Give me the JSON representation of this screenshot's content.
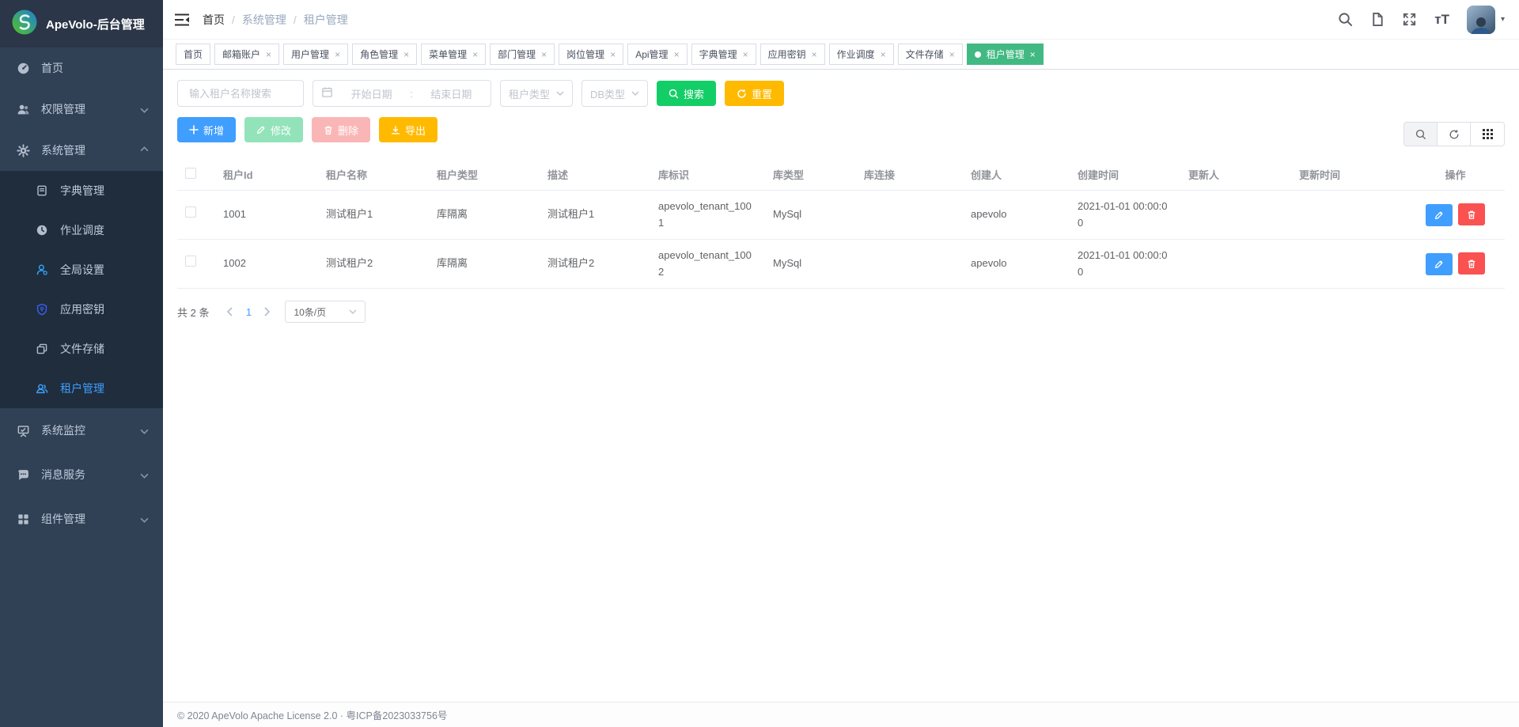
{
  "app": {
    "title": "ApeVolo-后台管理"
  },
  "colors": {
    "sidebar_bg": "#304156",
    "submenu_bg": "#1f2d3d",
    "active_link": "#409eff",
    "tab_active_bg": "#42b983",
    "primary": "#409eff",
    "success": "#13ce66",
    "warning": "#ffba00",
    "danger": "#fa5151",
    "edit_muted": "#92e3b9",
    "delete_muted": "#fab6b6"
  },
  "sidebar": {
    "items": [
      {
        "label": "首页",
        "icon": "dashboard-icon"
      },
      {
        "label": "权限管理",
        "icon": "users-icon"
      },
      {
        "label": "系统管理",
        "icon": "gear-icon",
        "children": [
          {
            "label": "字典管理",
            "icon": "book-icon"
          },
          {
            "label": "作业调度",
            "icon": "clock-icon"
          },
          {
            "label": "全局设置",
            "icon": "user-settings-icon"
          },
          {
            "label": "应用密钥",
            "icon": "shield-icon"
          },
          {
            "label": "文件存储",
            "icon": "copy-icon"
          },
          {
            "label": "租户管理",
            "icon": "tenant-icon",
            "active": true
          }
        ]
      },
      {
        "label": "系统监控",
        "icon": "monitor-icon"
      },
      {
        "label": "消息服务",
        "icon": "message-icon"
      },
      {
        "label": "组件管理",
        "icon": "components-icon"
      }
    ]
  },
  "header": {
    "breadcrumb": {
      "items": [
        "首页",
        "系统管理",
        "租户管理"
      ],
      "separator": "/"
    },
    "icons": {
      "font_size_glyph": "тT",
      "avatar_caret_glyph": "▾"
    }
  },
  "ui": {
    "close_glyph": "×"
  },
  "tabs": [
    {
      "label": "首页",
      "closable": false
    },
    {
      "label": "邮箱账户",
      "closable": true
    },
    {
      "label": "用户管理",
      "closable": true
    },
    {
      "label": "角色管理",
      "closable": true
    },
    {
      "label": "菜单管理",
      "closable": true
    },
    {
      "label": "部门管理",
      "closable": true
    },
    {
      "label": "岗位管理",
      "closable": true
    },
    {
      "label": "Api管理",
      "closable": true
    },
    {
      "label": "字典管理",
      "closable": true
    },
    {
      "label": "应用密钥",
      "closable": true
    },
    {
      "label": "作业调度",
      "closable": true
    },
    {
      "label": "文件存储",
      "closable": true
    },
    {
      "label": "租户管理",
      "closable": true,
      "active": true
    }
  ],
  "filters": {
    "name_placeholder": "输入租户名称搜索",
    "date_start_placeholder": "开始日期",
    "date_separator": ":",
    "date_end_placeholder": "结束日期",
    "tenant_type_placeholder": "租户类型",
    "db_type_placeholder": "DB类型",
    "search_label": "搜索",
    "reset_label": "重置"
  },
  "toolbar": {
    "add_label": "新增",
    "edit_label": "修改",
    "delete_label": "删除",
    "export_label": "导出"
  },
  "table": {
    "columns": [
      "租户Id",
      "租户名称",
      "租户类型",
      "描述",
      "库标识",
      "库类型",
      "库连接",
      "创建人",
      "创建时间",
      "更新人",
      "更新时间",
      "操作"
    ],
    "rows": [
      {
        "id": "1001",
        "name": "测试租户1",
        "type": "库隔离",
        "desc": "测试租户1",
        "db_id": "apevolo_tenant_1001",
        "db_type": "MySql",
        "db_conn": "",
        "creator": "apevolo",
        "create_time": "2021-01-01 00:00:00",
        "updater": "",
        "update_time": ""
      },
      {
        "id": "1002",
        "name": "测试租户2",
        "type": "库隔离",
        "desc": "测试租户2",
        "db_id": "apevolo_tenant_1002",
        "db_type": "MySql",
        "db_conn": "",
        "creator": "apevolo",
        "create_time": "2021-01-01 00:00:00",
        "updater": "",
        "update_time": ""
      }
    ]
  },
  "pagination": {
    "total_text": "共 2 条",
    "current_page": "1",
    "page_size": "10条/页"
  },
  "footer": {
    "copyright": "© 2020 ApeVolo Apache License 2.0 · 粤ICP备2023033756号"
  }
}
